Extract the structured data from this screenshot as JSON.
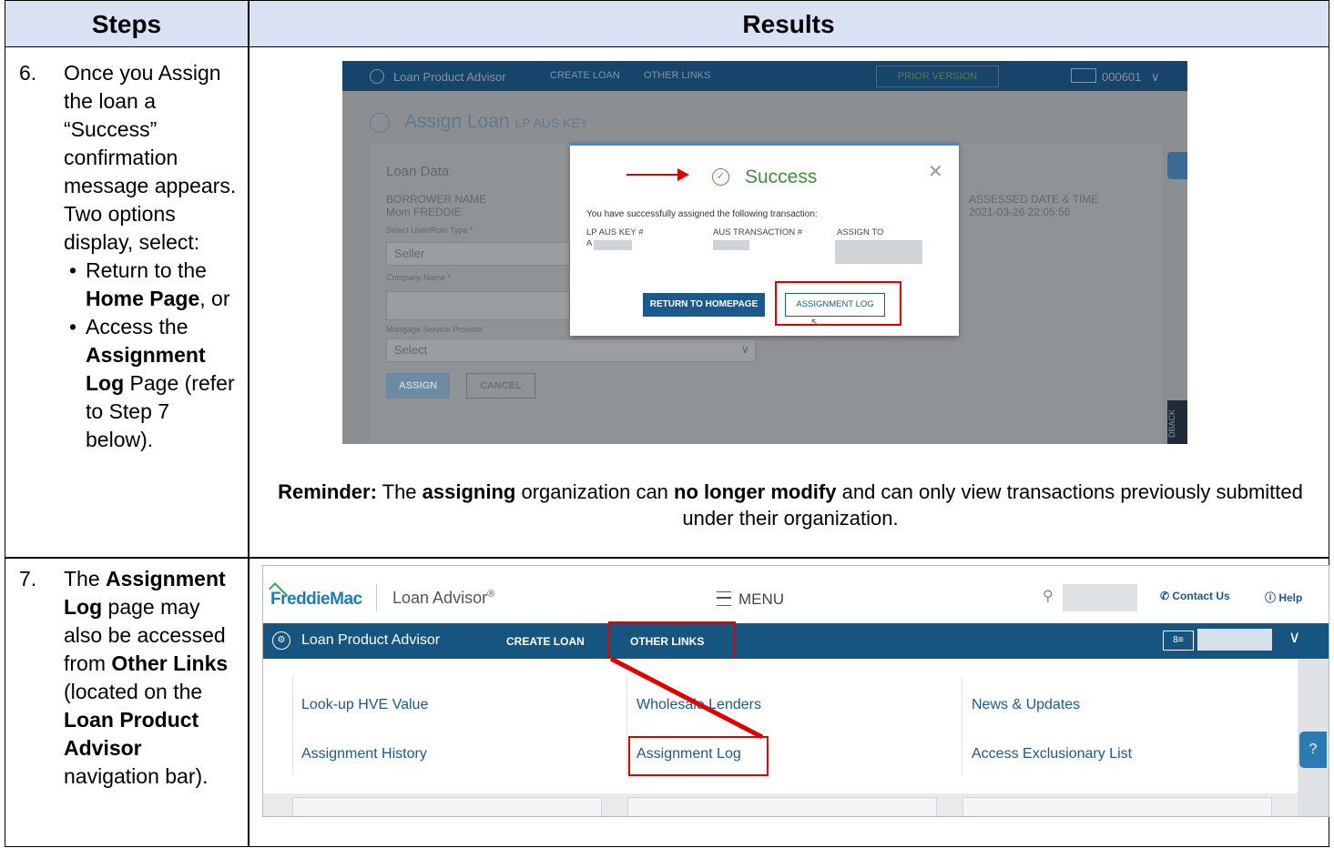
{
  "header": {
    "steps": "Steps",
    "results": "Results"
  },
  "step6": {
    "number": "6.",
    "line1": "Once you Assign the loan a “Success” confirmation message appears. Two options display, select:",
    "bullet1_pre": "Return to the ",
    "bullet1_bold": "Home Page",
    "bullet1_post": ", or",
    "bullet2_pre": "Access the ",
    "bullet2_bold": "Assignment Log",
    "bullet2_post": " Page (refer to Step 7 below)."
  },
  "step7": {
    "number": "7.",
    "t1": "The ",
    "b1": "Assignment Log",
    "t2": " page may also be accessed from ",
    "b2": "Other Links",
    "t3": " (located on the ",
    "b3": "Loan Product Advisor",
    "t4": " navigation bar)."
  },
  "shot1": {
    "nav": {
      "product": "Loan Product Advisor",
      "create": "CREATE LOAN",
      "other": "OTHER LINKS",
      "prior": "PRIOR VERSION",
      "user": "000601"
    },
    "title": "Assign Loan",
    "title_key": "LP AUS KEY",
    "loan_data": "Loan Data",
    "borrower_label": "BORROWER NAME",
    "borrower_value": "Mom FREDDIE",
    "role_label": "Select User/Role Type *",
    "role_value": "Seller",
    "company_label": "Company Name *",
    "msp_label": "Mortgage Service Provider",
    "msp_value": "Select",
    "assessed_label": "ASSESSED DATE & TIME",
    "assessed_value": "2021-03-26 22:05:56",
    "assign_btn": "ASSIGN",
    "cancel_btn": "CANCEL",
    "feedback": "DBACK",
    "modal": {
      "title": "Success",
      "message": "You have successfully assigned the following transaction:",
      "col1": "LP AUS KEY #",
      "col1_value": "A",
      "col2": "AUS TRANSACTION #",
      "col3": "ASSIGN TO",
      "btn_home": "RETURN TO HOMEPAGE",
      "btn_log": "ASSIGNMENT LOG"
    }
  },
  "reminder": {
    "label": "Reminder:",
    "t1": " The ",
    "b1": "assigning",
    "t2": " organization can ",
    "b2": "no longer modify",
    "t3": " and can only view transactions previously submitted under their organization."
  },
  "shot2": {
    "logo": "FreddieMac",
    "app": "Loan Advisor",
    "app_reg": "®",
    "menu": "MENU",
    "contact": "Contact Us",
    "help": "Help",
    "nav": {
      "product": "Loan Product Advisor",
      "create": "CREATE LOAN",
      "other": "OTHER LINKS"
    },
    "links": {
      "hve": "Look-up HVE Value",
      "wholesale": "Wholesale Lenders",
      "news": "News & Updates",
      "history": "Assignment History",
      "log": "Assignment Log",
      "exclusionary": "Access Exclusionary List"
    }
  }
}
